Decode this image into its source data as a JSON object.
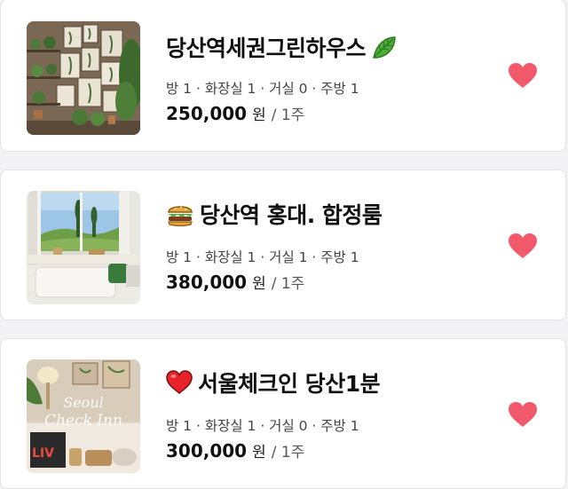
{
  "listings": [
    {
      "title": "당산역세권그린하우스",
      "title_icon": "leaf-icon",
      "meta": "방 1 · 화장실 1 · 거실 0 · 주방 1",
      "price": "250,000",
      "currency": "원",
      "period": "/ 1주",
      "favorited": true
    },
    {
      "title": "당산역 홍대. 합정룸",
      "title_icon": "burger-icon",
      "meta": "방 1 · 화장실 1 · 거실 1 · 주방 1",
      "price": "380,000",
      "currency": "원",
      "period": "/ 1주",
      "favorited": true
    },
    {
      "title": "서울체크인 당산1분",
      "title_icon": "red-heart-icon",
      "meta": "방 1 · 화장실 1 · 거실 0 · 주방 1",
      "price": "300,000",
      "currency": "원",
      "period": "/ 1주",
      "favorited": true,
      "thumb_text": "Seoul Check Inn"
    }
  ],
  "colors": {
    "favorite_heart": "#f25a6b",
    "card_border": "#e4e4e8",
    "background": "#f3f3f5"
  }
}
